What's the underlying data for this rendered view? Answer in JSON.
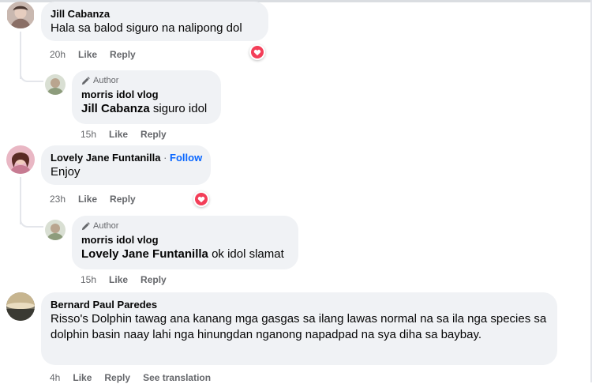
{
  "labels": {
    "like": "Like",
    "reply": "Reply",
    "author": "Author",
    "see_translation": "See translation",
    "follow": "Follow",
    "separator": "·"
  },
  "colors": {
    "bubble": "#f0f2f5",
    "meta": "#65676b",
    "link": "#0866ff",
    "love": "#f33e58"
  },
  "comments": [
    {
      "name": "Jill Cabanza",
      "text": "Hala sa balod siguro na nalipong dol",
      "time": "20h",
      "reaction": "heart-icon",
      "reply": {
        "name": "morris idol vlog",
        "mention": "Jill Cabanza",
        "text": "siguro idol",
        "time": "15h"
      }
    },
    {
      "name": "Lovely Jane Funtanilla",
      "text": "Enjoy",
      "time": "23h",
      "reaction": "heart-icon",
      "reply": {
        "name": "morris idol vlog",
        "mention": "Lovely Jane Funtanilla",
        "text": "ok idol slamat",
        "time": "15h"
      }
    },
    {
      "name": "Bernard Paul Paredes",
      "text": "Risso's Dolphin tawag ana kanang mga gasgas sa ilang lawas normal na sa ila nga species sa dolphin basin naay lahi nga hinungdan nganong napadpad na sya diha sa baybay.",
      "time": "4h"
    }
  ]
}
